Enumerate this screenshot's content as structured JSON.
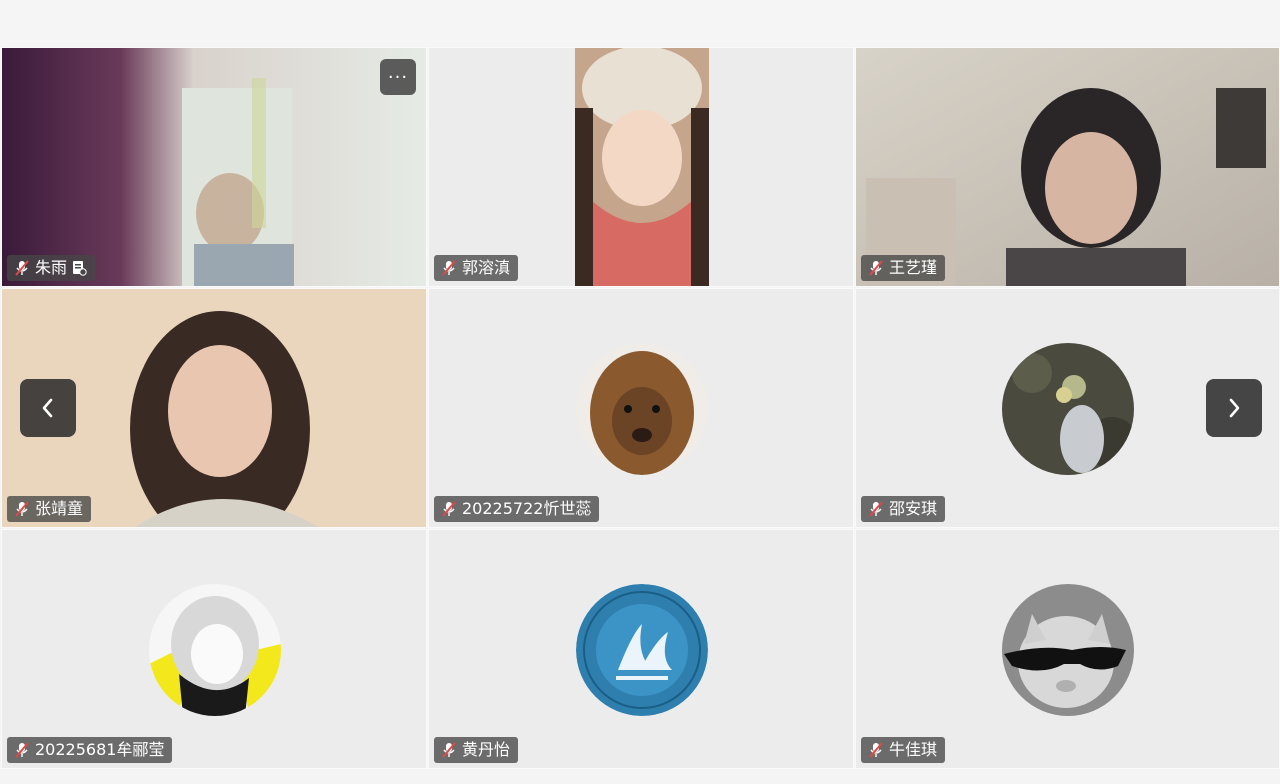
{
  "participants": [
    {
      "name": "朱雨",
      "mic": "muted",
      "video": "on",
      "extra_icon": "share-doc-icon"
    },
    {
      "name": "郭溶滇",
      "mic": "muted",
      "video": "on"
    },
    {
      "name": "王艺瑾",
      "mic": "muted",
      "video": "on"
    },
    {
      "name": "张靖童",
      "mic": "muted",
      "video": "on"
    },
    {
      "name": "20225722忻世蕊",
      "mic": "muted",
      "video": "off",
      "avatar": "alpaca-avatar"
    },
    {
      "name": "邵安琪",
      "mic": "muted",
      "video": "off",
      "avatar": "girl-with-flowers-avatar"
    },
    {
      "name": "20225681牟郦莹",
      "mic": "muted",
      "video": "off",
      "avatar": "anime-girl-avatar"
    },
    {
      "name": "黄丹怡",
      "mic": "muted",
      "video": "off",
      "avatar": "university-logo-avatar"
    },
    {
      "name": "牛佳琪",
      "mic": "muted",
      "video": "off",
      "avatar": "cat-sunglasses-avatar"
    }
  ],
  "controls": {
    "more_label": "···",
    "prev_icon": "chevron-left-icon",
    "next_icon": "chevron-right-icon"
  },
  "colors": {
    "tile_bg": "#ececec",
    "tag_bg": "#464646",
    "mic_muted": "#e04848",
    "nav_bg": "#2d2d2d"
  }
}
